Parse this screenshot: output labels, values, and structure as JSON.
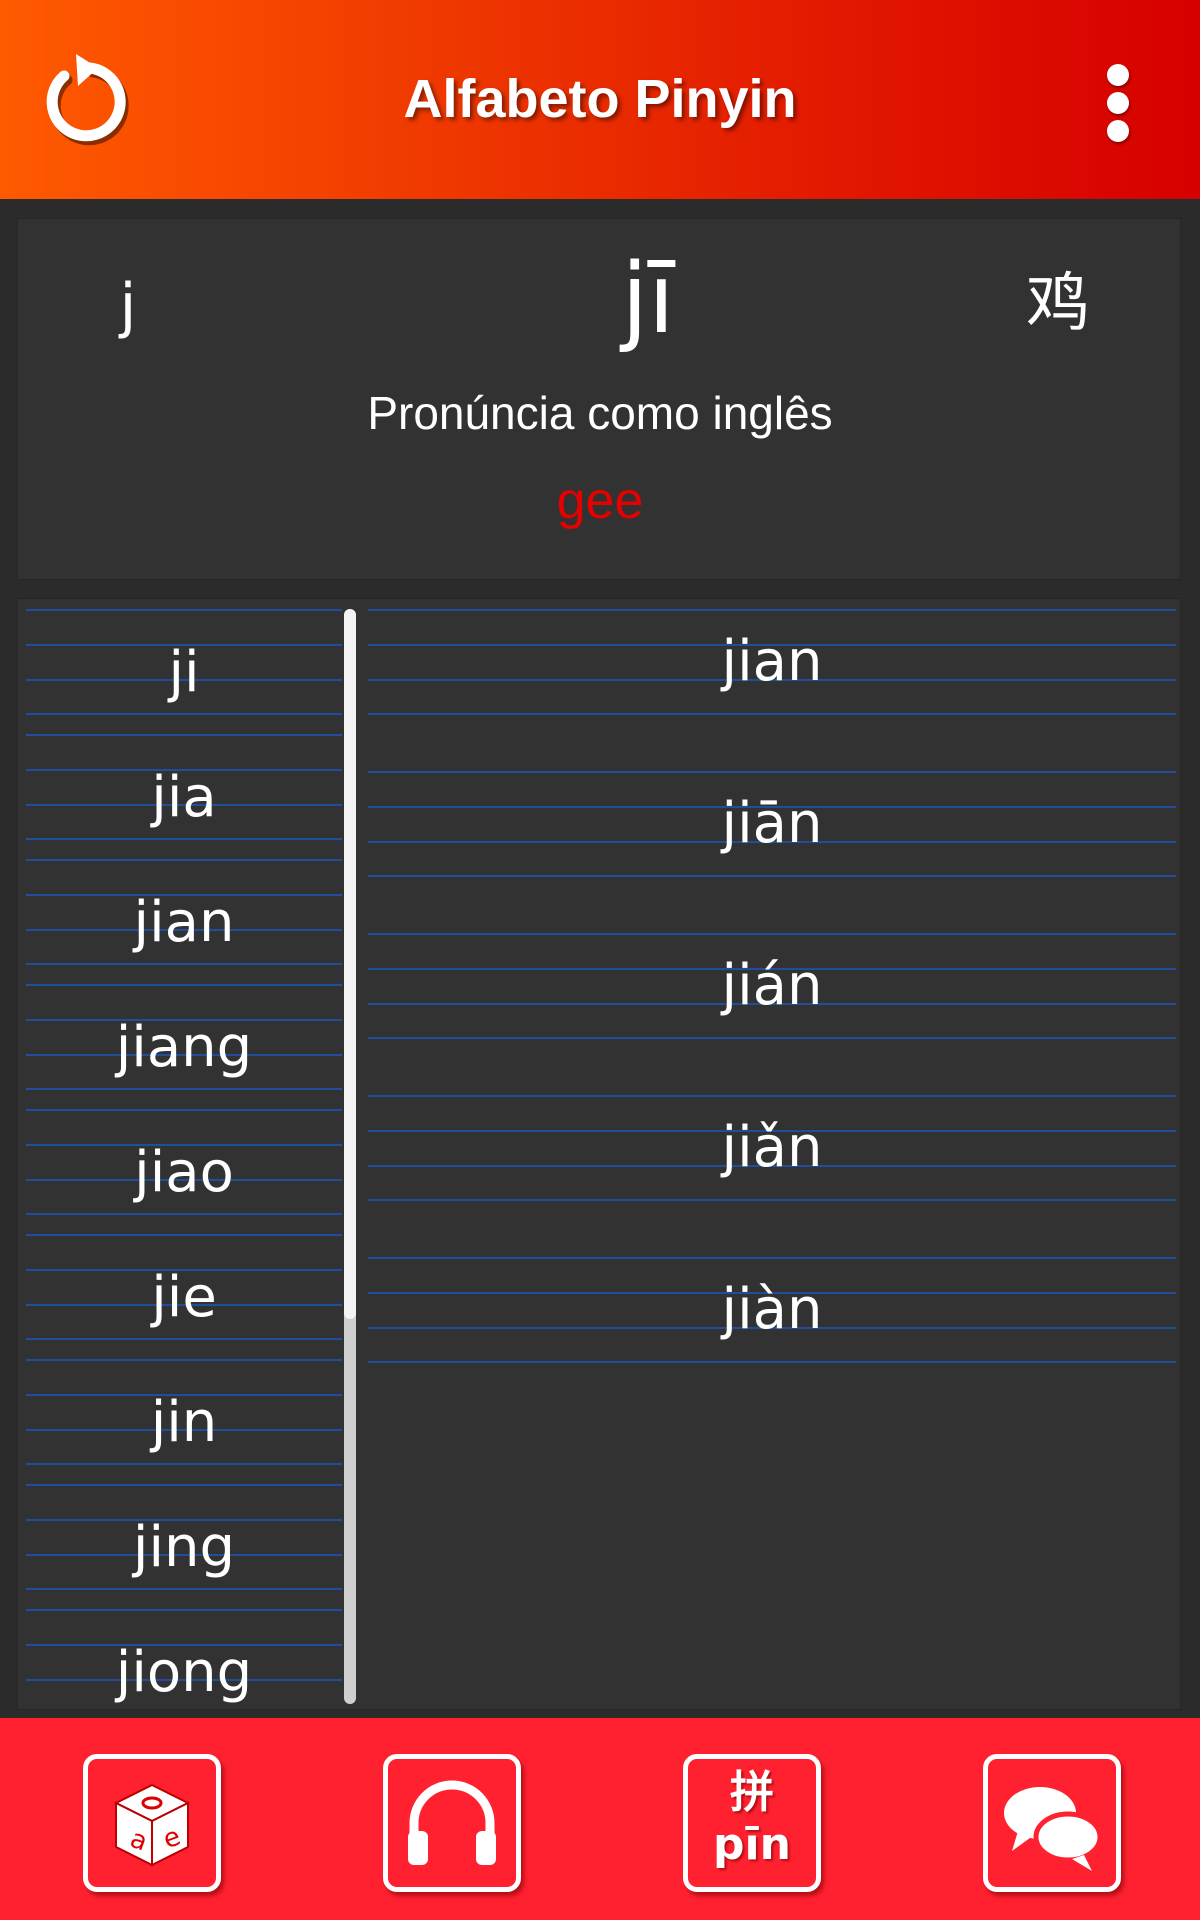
{
  "header": {
    "title": "Alfabeto Pinyin",
    "refresh_icon": "refresh-icon",
    "menu_icon": "more-vertical-icon"
  },
  "info": {
    "initial": "j",
    "syllable": "jī",
    "hanzi": "鸡",
    "pronunciation_label": "Pronúncia como inglês",
    "pronunciation_value": "gee"
  },
  "left_list": {
    "items": [
      "ji",
      "jia",
      "jian",
      "jiang",
      "jiao",
      "jie",
      "jin",
      "jing",
      "jiong"
    ]
  },
  "right_list": {
    "items": [
      "jian",
      "jiān",
      "jián",
      "jiǎn",
      "jiàn"
    ]
  },
  "bottom_nav": {
    "items": [
      {
        "icon": "dice-icon"
      },
      {
        "icon": "headphones-icon"
      },
      {
        "icon": "pinyin-icon",
        "top_text": "拼",
        "bottom_text": "pīn"
      },
      {
        "icon": "chat-bubbles-icon"
      }
    ]
  },
  "colors": {
    "header_start": "#ff5a00",
    "header_end": "#d60000",
    "accent_red": "#e60000",
    "bottom_bar": "#ff2130",
    "rule_line": "#1f4f9a"
  }
}
